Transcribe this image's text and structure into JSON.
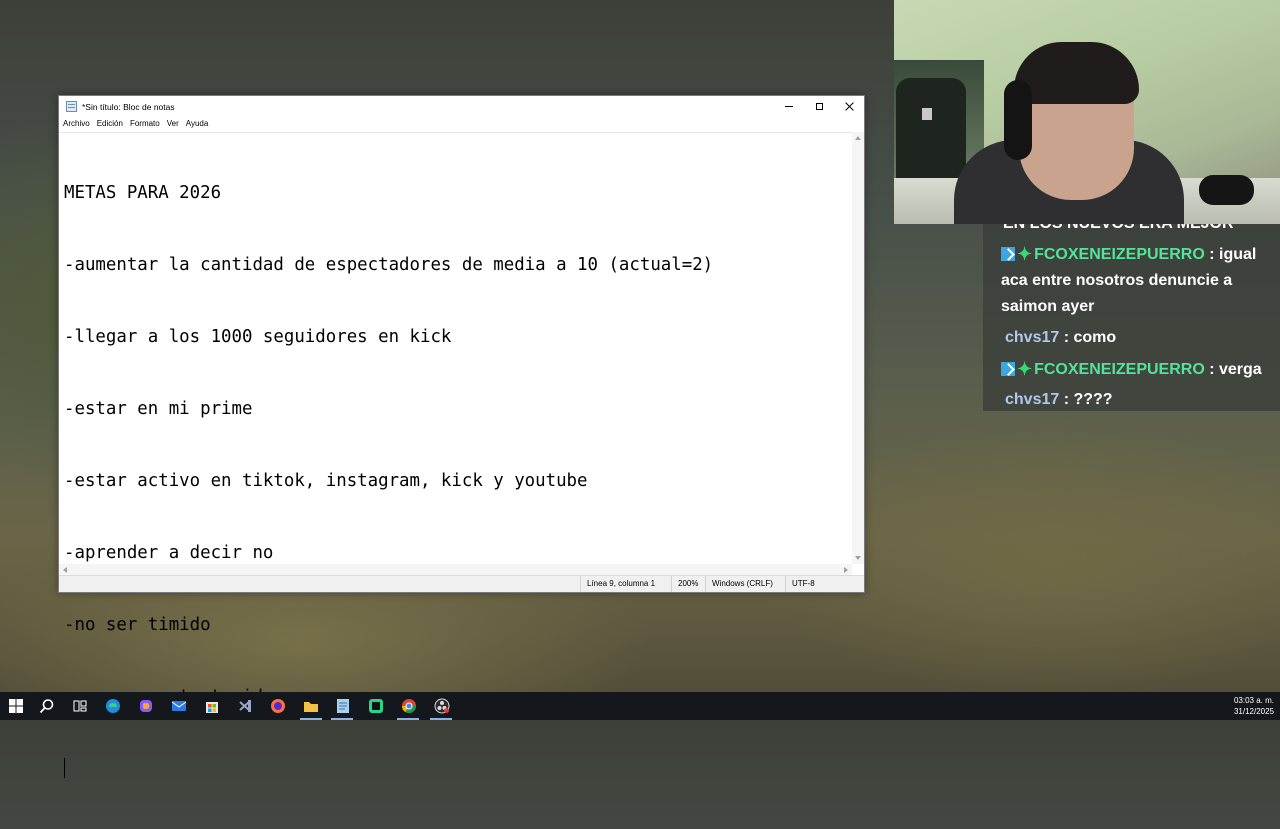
{
  "notepad": {
    "title": "*Sin título: Bloc de notas",
    "menu": [
      "Archivo",
      "Edición",
      "Formato",
      "Ver",
      "Ayuda"
    ],
    "lines": [
      "METAS PARA 2026",
      "-aumentar la cantidad de espectadores de media a 10 (actual=2)",
      "-llegar a los 1000 seguidores en kick",
      "-estar en mi prime",
      "-estar activo en tiktok, instagram, kick y youtube",
      "-aprender a decir no",
      "-no ser timido",
      "-ser mas entretenido"
    ],
    "status": {
      "position": "Línea 9, columna 1",
      "zoom": "200%",
      "line_ending": "Windows (CRLF)",
      "encoding": "UTF-8"
    }
  },
  "chat": {
    "partial_top": "EN LOS NUEVOS ERA MEJOR",
    "messages": [
      {
        "user": "FCOXENEIZEPUERRO",
        "text": " : igual aca entre nosotros denuncie a saimon ayer",
        "badges": true
      },
      {
        "user": "chvs17",
        "text": " : como",
        "badges": false
      },
      {
        "user": "FCOXENEIZEPUERRO",
        "text": " : verga",
        "badges": true
      },
      {
        "user": "chvs17",
        "text": " : ????",
        "badges": false
      }
    ]
  },
  "taskbar": {
    "icons": [
      "windows-start-icon",
      "search-icon",
      "task-view-icon",
      "edge-icon",
      "copilot-icon",
      "mail-icon",
      "store-icon",
      "visual-studio-icon",
      "firefox-icon",
      "file-explorer-icon",
      "notepad-icon",
      "pycharm-icon",
      "chrome-icon",
      "obs-icon"
    ],
    "clock_time": "03:03 a. m.",
    "clock_date": "31/12/2025",
    "colors": {
      "bar": "#14181c",
      "active_indicator": "#8ab4e6"
    }
  }
}
